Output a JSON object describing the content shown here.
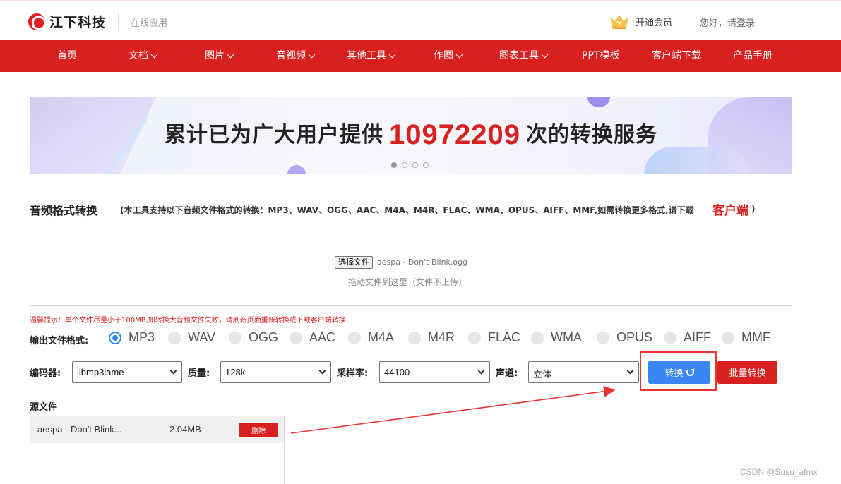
{
  "header": {
    "logo_text": "江下科技",
    "subtitle": "在线应用",
    "vip_label": "开通会员",
    "login_text": "您好，请登录"
  },
  "nav": [
    {
      "label": "首页",
      "dropdown": false
    },
    {
      "label": "文档",
      "dropdown": true
    },
    {
      "label": "图片",
      "dropdown": true
    },
    {
      "label": "音视频",
      "dropdown": true
    },
    {
      "label": "其他工具",
      "dropdown": true
    },
    {
      "label": "作图",
      "dropdown": true
    },
    {
      "label": "图表工具",
      "dropdown": true
    },
    {
      "label": "PPT模板",
      "dropdown": false
    },
    {
      "label": "客户端下载",
      "dropdown": false
    },
    {
      "label": "产品手册",
      "dropdown": false
    }
  ],
  "banner": {
    "text_before": "累计已为广大用户提供",
    "count": "10972209",
    "text_after": "次的转换服务",
    "slide_count": 4,
    "active_slide": 1
  },
  "tool": {
    "title": "音频格式转换",
    "description": "(本工具支持以下音频文件格式的转换：MP3、WAV、OGG、AAC、M4A、M4R、FLAC、WMA、OPUS、AIFF、MMF,如需转换更多格式,请下载",
    "client_link": "客户端",
    "closing_paren": ")"
  },
  "upload": {
    "choose_button": "选择文件",
    "file_name": "aespa - Don't Blink.ogg",
    "drop_hint": "拖动文件到这里（文件不上传)"
  },
  "warning": "温馨提示：单个文件尽量小于100MB,如转换大音频文件失败，请刷新页面重新转换或下载客户端转换",
  "formats": {
    "label": "输出文件格式:",
    "options": [
      "MP3",
      "WAV",
      "OGG",
      "AAC",
      "M4A",
      "M4R",
      "FLAC",
      "WMA",
      "OPUS",
      "AIFF",
      "MMF"
    ],
    "selected": "MP3"
  },
  "settings": {
    "encoder_label": "编码器:",
    "encoder_value": "libmp3lame",
    "quality_label": "质量:",
    "quality_value": "128k",
    "samplerate_label": "采样率:",
    "samplerate_value": "44100",
    "channel_label": "声道:",
    "channel_value": "立体"
  },
  "actions": {
    "convert_label": "转换",
    "batch_label": "批量转换"
  },
  "source": {
    "label": "源文件",
    "files": [
      {
        "name": "aespa - Don't Blink...",
        "size": "2.04MB",
        "delete_label": "删除"
      }
    ]
  },
  "watermark": "CSDN @Susu_afmx",
  "colors": {
    "brand_red": "#d8201f",
    "accent_blue": "#3a86f5",
    "annotation_red": "#e33"
  }
}
